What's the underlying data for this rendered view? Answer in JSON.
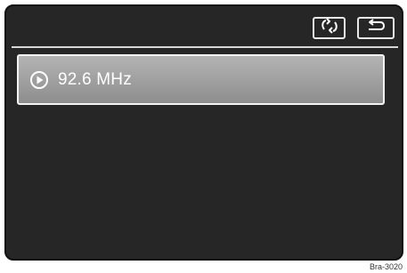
{
  "header": {
    "refresh_icon": "refresh-icon",
    "back_icon": "back-icon"
  },
  "station_list": {
    "items": [
      {
        "label": "92.6 MHz",
        "icon": "play-icon"
      }
    ]
  },
  "figure_code": "Bra-3020",
  "colors": {
    "screen_background": "#262626",
    "station_item_top": "#b4b4b4",
    "station_item_bottom": "#8d8d8d",
    "border_light": "#f2f2f2"
  }
}
